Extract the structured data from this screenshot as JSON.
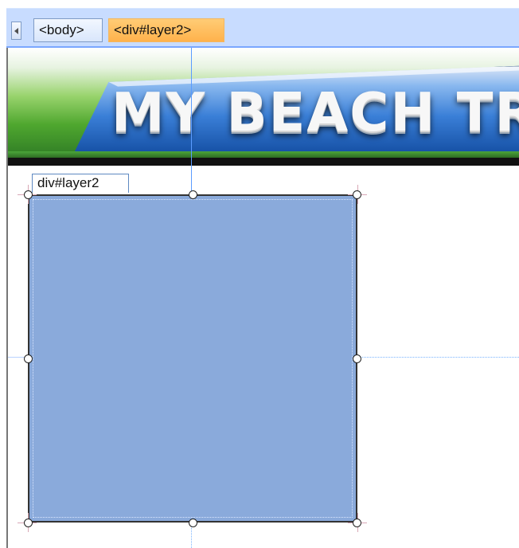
{
  "tag_selector": {
    "tags": [
      "<body>",
      "<div#layer2>"
    ]
  },
  "banner": {
    "title": "MY BEACH TR"
  },
  "layer": {
    "label": "div#layer2"
  },
  "colors": {
    "layer_fill": "#8aaadb",
    "active_tag": "#ffb24c",
    "tag_bar": "#c8dcff"
  },
  "icons": {
    "scroll_left": "chevron-left-icon"
  }
}
